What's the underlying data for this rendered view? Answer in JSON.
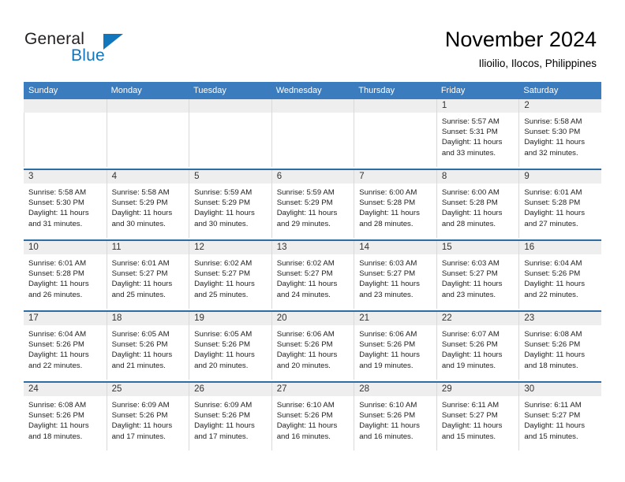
{
  "logo": {
    "word_one": "General",
    "word_two": "Blue",
    "triangle_icon": "triangle-icon",
    "brand_color": "#1176bc"
  },
  "header": {
    "title": "November 2024",
    "subtitle": "Ilioilio, Ilocos, Philippines"
  },
  "theme": {
    "header_blue": "#3b7cbf",
    "divider_blue": "#2e6da4",
    "daynum_band": "#eeeeee",
    "cell_border": "#d9d9d9"
  },
  "weekdays": [
    "Sunday",
    "Monday",
    "Tuesday",
    "Wednesday",
    "Thursday",
    "Friday",
    "Saturday"
  ],
  "weeks": [
    [
      {
        "day": "",
        "sunrise": "",
        "sunset": "",
        "daylight_line1": "",
        "daylight_line2": ""
      },
      {
        "day": "",
        "sunrise": "",
        "sunset": "",
        "daylight_line1": "",
        "daylight_line2": ""
      },
      {
        "day": "",
        "sunrise": "",
        "sunset": "",
        "daylight_line1": "",
        "daylight_line2": ""
      },
      {
        "day": "",
        "sunrise": "",
        "sunset": "",
        "daylight_line1": "",
        "daylight_line2": ""
      },
      {
        "day": "",
        "sunrise": "",
        "sunset": "",
        "daylight_line1": "",
        "daylight_line2": ""
      },
      {
        "day": "1",
        "sunrise": "Sunrise: 5:57 AM",
        "sunset": "Sunset: 5:31 PM",
        "daylight_line1": "Daylight: 11 hours",
        "daylight_line2": "and 33 minutes."
      },
      {
        "day": "2",
        "sunrise": "Sunrise: 5:58 AM",
        "sunset": "Sunset: 5:30 PM",
        "daylight_line1": "Daylight: 11 hours",
        "daylight_line2": "and 32 minutes."
      }
    ],
    [
      {
        "day": "3",
        "sunrise": "Sunrise: 5:58 AM",
        "sunset": "Sunset: 5:30 PM",
        "daylight_line1": "Daylight: 11 hours",
        "daylight_line2": "and 31 minutes."
      },
      {
        "day": "4",
        "sunrise": "Sunrise: 5:58 AM",
        "sunset": "Sunset: 5:29 PM",
        "daylight_line1": "Daylight: 11 hours",
        "daylight_line2": "and 30 minutes."
      },
      {
        "day": "5",
        "sunrise": "Sunrise: 5:59 AM",
        "sunset": "Sunset: 5:29 PM",
        "daylight_line1": "Daylight: 11 hours",
        "daylight_line2": "and 30 minutes."
      },
      {
        "day": "6",
        "sunrise": "Sunrise: 5:59 AM",
        "sunset": "Sunset: 5:29 PM",
        "daylight_line1": "Daylight: 11 hours",
        "daylight_line2": "and 29 minutes."
      },
      {
        "day": "7",
        "sunrise": "Sunrise: 6:00 AM",
        "sunset": "Sunset: 5:28 PM",
        "daylight_line1": "Daylight: 11 hours",
        "daylight_line2": "and 28 minutes."
      },
      {
        "day": "8",
        "sunrise": "Sunrise: 6:00 AM",
        "sunset": "Sunset: 5:28 PM",
        "daylight_line1": "Daylight: 11 hours",
        "daylight_line2": "and 28 minutes."
      },
      {
        "day": "9",
        "sunrise": "Sunrise: 6:01 AM",
        "sunset": "Sunset: 5:28 PM",
        "daylight_line1": "Daylight: 11 hours",
        "daylight_line2": "and 27 minutes."
      }
    ],
    [
      {
        "day": "10",
        "sunrise": "Sunrise: 6:01 AM",
        "sunset": "Sunset: 5:28 PM",
        "daylight_line1": "Daylight: 11 hours",
        "daylight_line2": "and 26 minutes."
      },
      {
        "day": "11",
        "sunrise": "Sunrise: 6:01 AM",
        "sunset": "Sunset: 5:27 PM",
        "daylight_line1": "Daylight: 11 hours",
        "daylight_line2": "and 25 minutes."
      },
      {
        "day": "12",
        "sunrise": "Sunrise: 6:02 AM",
        "sunset": "Sunset: 5:27 PM",
        "daylight_line1": "Daylight: 11 hours",
        "daylight_line2": "and 25 minutes."
      },
      {
        "day": "13",
        "sunrise": "Sunrise: 6:02 AM",
        "sunset": "Sunset: 5:27 PM",
        "daylight_line1": "Daylight: 11 hours",
        "daylight_line2": "and 24 minutes."
      },
      {
        "day": "14",
        "sunrise": "Sunrise: 6:03 AM",
        "sunset": "Sunset: 5:27 PM",
        "daylight_line1": "Daylight: 11 hours",
        "daylight_line2": "and 23 minutes."
      },
      {
        "day": "15",
        "sunrise": "Sunrise: 6:03 AM",
        "sunset": "Sunset: 5:27 PM",
        "daylight_line1": "Daylight: 11 hours",
        "daylight_line2": "and 23 minutes."
      },
      {
        "day": "16",
        "sunrise": "Sunrise: 6:04 AM",
        "sunset": "Sunset: 5:26 PM",
        "daylight_line1": "Daylight: 11 hours",
        "daylight_line2": "and 22 minutes."
      }
    ],
    [
      {
        "day": "17",
        "sunrise": "Sunrise: 6:04 AM",
        "sunset": "Sunset: 5:26 PM",
        "daylight_line1": "Daylight: 11 hours",
        "daylight_line2": "and 22 minutes."
      },
      {
        "day": "18",
        "sunrise": "Sunrise: 6:05 AM",
        "sunset": "Sunset: 5:26 PM",
        "daylight_line1": "Daylight: 11 hours",
        "daylight_line2": "and 21 minutes."
      },
      {
        "day": "19",
        "sunrise": "Sunrise: 6:05 AM",
        "sunset": "Sunset: 5:26 PM",
        "daylight_line1": "Daylight: 11 hours",
        "daylight_line2": "and 20 minutes."
      },
      {
        "day": "20",
        "sunrise": "Sunrise: 6:06 AM",
        "sunset": "Sunset: 5:26 PM",
        "daylight_line1": "Daylight: 11 hours",
        "daylight_line2": "and 20 minutes."
      },
      {
        "day": "21",
        "sunrise": "Sunrise: 6:06 AM",
        "sunset": "Sunset: 5:26 PM",
        "daylight_line1": "Daylight: 11 hours",
        "daylight_line2": "and 19 minutes."
      },
      {
        "day": "22",
        "sunrise": "Sunrise: 6:07 AM",
        "sunset": "Sunset: 5:26 PM",
        "daylight_line1": "Daylight: 11 hours",
        "daylight_line2": "and 19 minutes."
      },
      {
        "day": "23",
        "sunrise": "Sunrise: 6:08 AM",
        "sunset": "Sunset: 5:26 PM",
        "daylight_line1": "Daylight: 11 hours",
        "daylight_line2": "and 18 minutes."
      }
    ],
    [
      {
        "day": "24",
        "sunrise": "Sunrise: 6:08 AM",
        "sunset": "Sunset: 5:26 PM",
        "daylight_line1": "Daylight: 11 hours",
        "daylight_line2": "and 18 minutes."
      },
      {
        "day": "25",
        "sunrise": "Sunrise: 6:09 AM",
        "sunset": "Sunset: 5:26 PM",
        "daylight_line1": "Daylight: 11 hours",
        "daylight_line2": "and 17 minutes."
      },
      {
        "day": "26",
        "sunrise": "Sunrise: 6:09 AM",
        "sunset": "Sunset: 5:26 PM",
        "daylight_line1": "Daylight: 11 hours",
        "daylight_line2": "and 17 minutes."
      },
      {
        "day": "27",
        "sunrise": "Sunrise: 6:10 AM",
        "sunset": "Sunset: 5:26 PM",
        "daylight_line1": "Daylight: 11 hours",
        "daylight_line2": "and 16 minutes."
      },
      {
        "day": "28",
        "sunrise": "Sunrise: 6:10 AM",
        "sunset": "Sunset: 5:26 PM",
        "daylight_line1": "Daylight: 11 hours",
        "daylight_line2": "and 16 minutes."
      },
      {
        "day": "29",
        "sunrise": "Sunrise: 6:11 AM",
        "sunset": "Sunset: 5:27 PM",
        "daylight_line1": "Daylight: 11 hours",
        "daylight_line2": "and 15 minutes."
      },
      {
        "day": "30",
        "sunrise": "Sunrise: 6:11 AM",
        "sunset": "Sunset: 5:27 PM",
        "daylight_line1": "Daylight: 11 hours",
        "daylight_line2": "and 15 minutes."
      }
    ]
  ]
}
